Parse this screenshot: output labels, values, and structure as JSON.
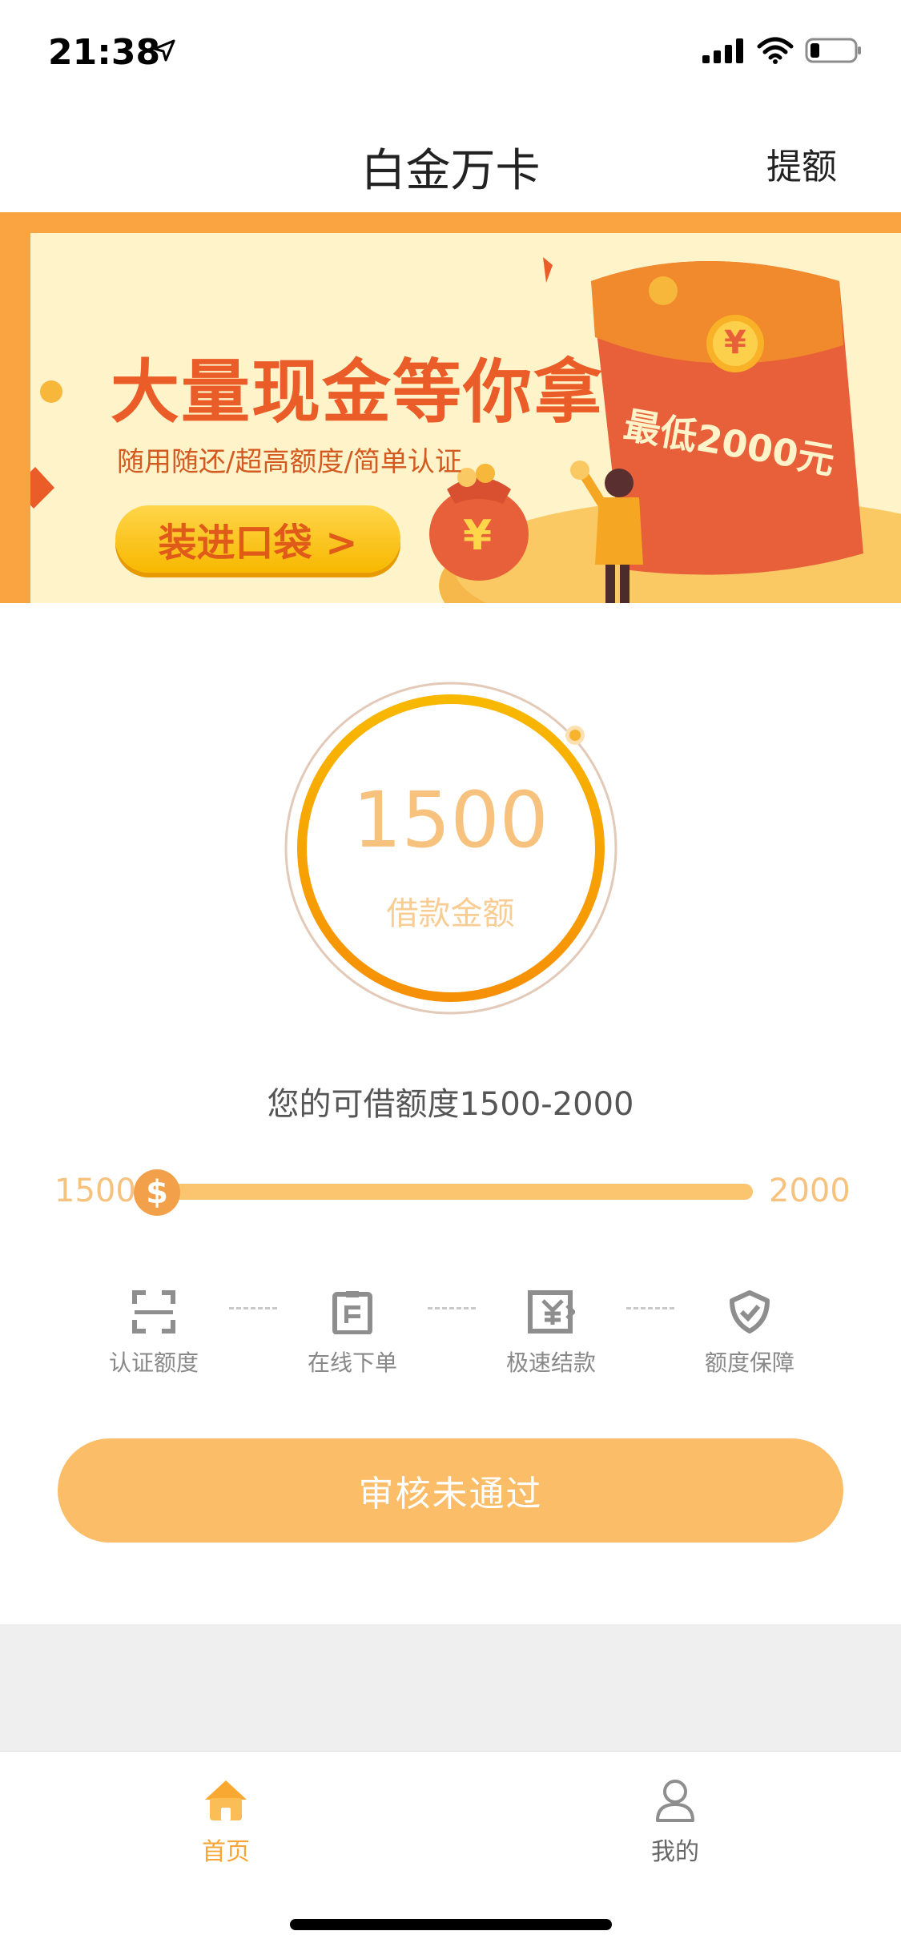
{
  "status_bar": {
    "time": "21:38"
  },
  "nav": {
    "title": "白金万卡",
    "action": "提额"
  },
  "banner": {
    "headline": "大量现金等你拿",
    "subline": "随用随还/超高额度/简单认证",
    "button": "装进口袋 >",
    "envelope_text": "最低2000元",
    "currency_symbol": "¥"
  },
  "loan": {
    "amount": "1500",
    "amount_label": "借款金额",
    "range_text": "您的可借额度1500-2000",
    "slider_min": "1500",
    "slider_max": "2000",
    "slider_value_fraction": 0,
    "slider_thumb_symbol": "$"
  },
  "steps": [
    {
      "label": "认证额度",
      "icon": "scan-frame-icon"
    },
    {
      "label": "在线下单",
      "icon": "clipboard-icon"
    },
    {
      "label": "极速结款",
      "icon": "fast-cash-icon"
    },
    {
      "label": "额度保障",
      "icon": "shield-check-icon"
    }
  ],
  "cta": {
    "label": "审核未通过"
  },
  "tabs": [
    {
      "label": "首页",
      "icon": "home-icon",
      "active": true
    },
    {
      "label": "我的",
      "icon": "user-icon",
      "active": false
    }
  ],
  "colors": {
    "accent": "#f6a637",
    "accent_light": "#fbbd68",
    "banner_bg": "#fff3c9",
    "banner_border": "#f9a441",
    "headline_red": "#ea5d28",
    "envelope_red": "#e8603a"
  }
}
